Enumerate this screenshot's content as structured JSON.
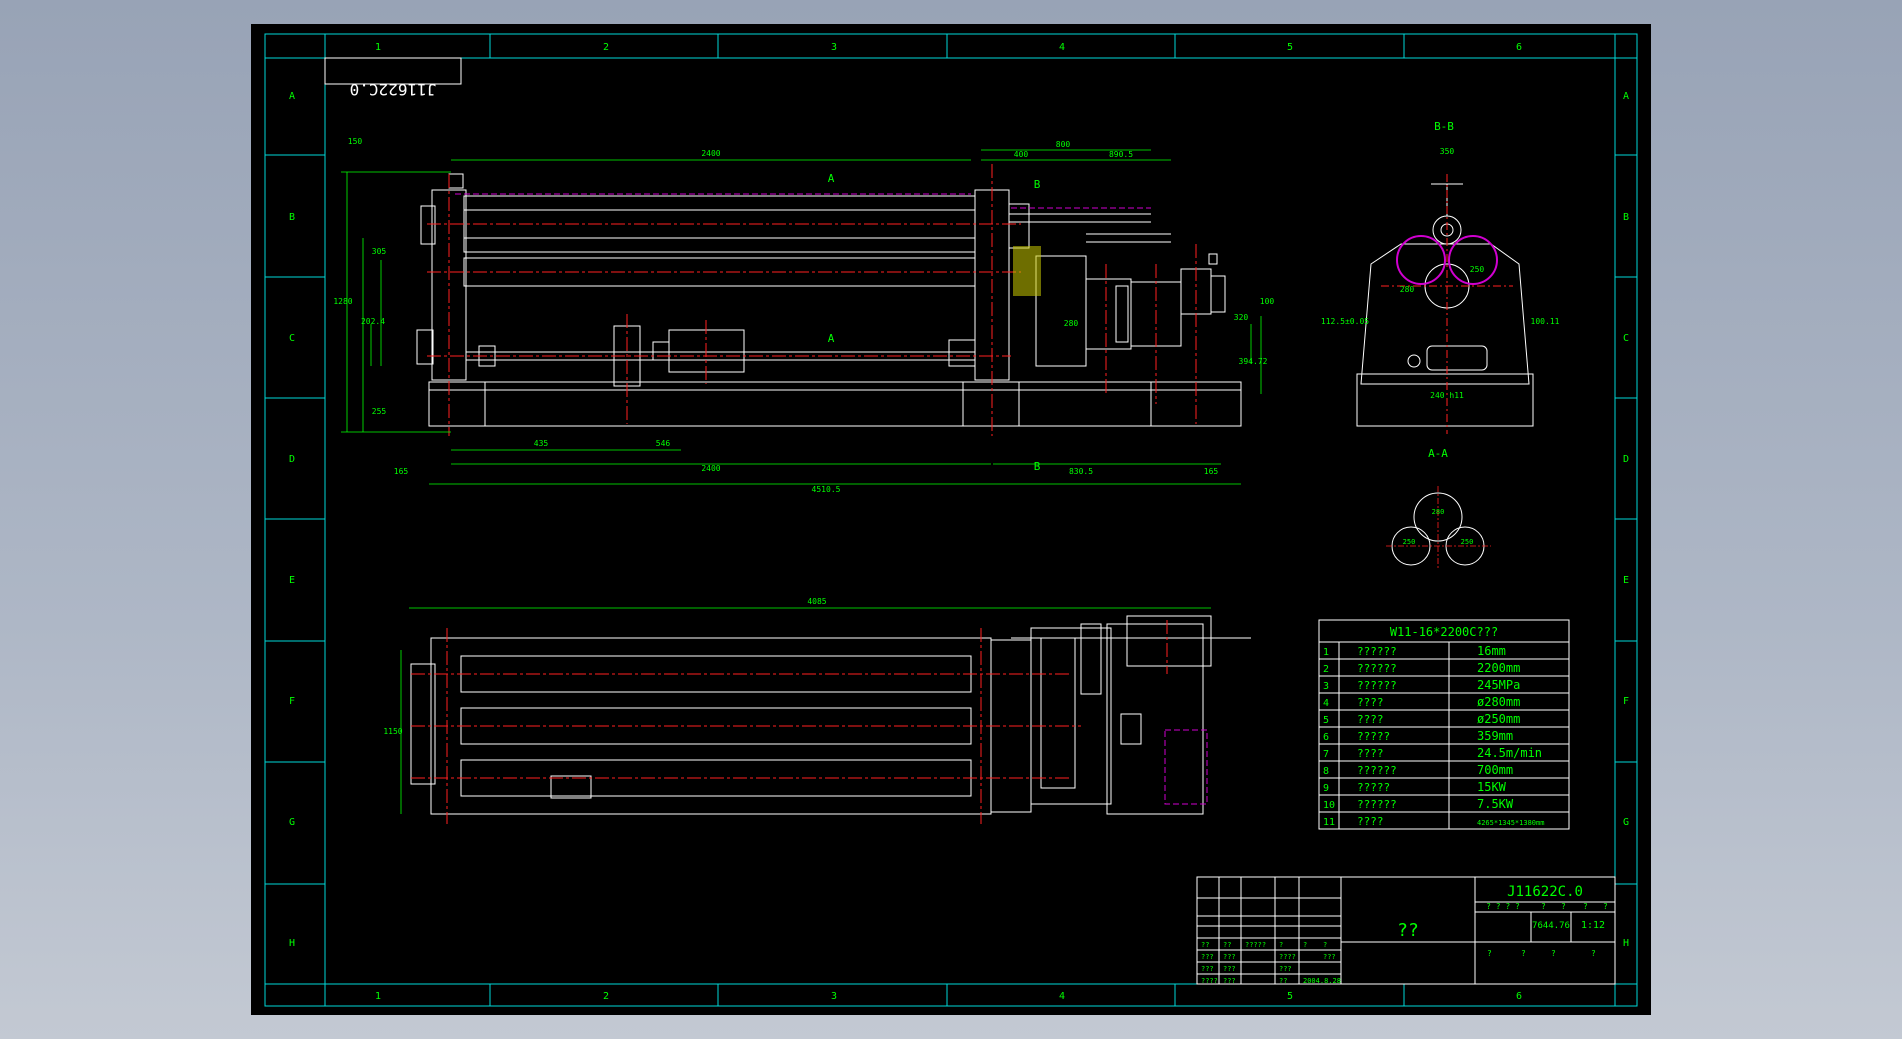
{
  "drawing": {
    "mirrored_code": "J11622C.0",
    "col_numbers": [
      "1",
      "2",
      "3",
      "4",
      "5",
      "6"
    ],
    "row_letters": [
      "A",
      "B",
      "C",
      "D",
      "E",
      "F",
      "G",
      "H"
    ],
    "row_letters_right": [
      "A",
      "B",
      "C",
      "D",
      "E",
      "F",
      "G",
      "H"
    ]
  },
  "front_view": {
    "section_a_top": "A",
    "section_a_bottom": "A",
    "section_b_top": "B",
    "section_b_bottom": "B",
    "dims_top": [
      "2400",
      "400",
      "800",
      "890.5",
      "150"
    ],
    "dims_left": [
      "1280",
      "305",
      "255",
      "202.4"
    ],
    "dims_right": [
      "320",
      "280",
      "394.72",
      "100"
    ],
    "dims_bottom": [
      "435",
      "546",
      "2400",
      "165",
      "165",
      "4510.5",
      "830.5",
      "165"
    ]
  },
  "section_bb": {
    "label": "B-B",
    "dims": [
      "350",
      "280",
      "250",
      "112.5±0.05",
      "100.11",
      "240 h11"
    ]
  },
  "section_aa": {
    "label": "A-A",
    "dims": [
      "280",
      "250",
      "250"
    ]
  },
  "top_view": {
    "dims": [
      "4085",
      "1150"
    ]
  },
  "spec_table": {
    "title": "W11-16*2200C???",
    "rows": [
      {
        "no": "1",
        "name": "??????",
        "value": "16mm"
      },
      {
        "no": "2",
        "name": "??????",
        "value": "2200mm"
      },
      {
        "no": "3",
        "name": "??????",
        "value": "245MPa"
      },
      {
        "no": "4",
        "name": "????",
        "value": "ø280mm"
      },
      {
        "no": "5",
        "name": "????",
        "value": "ø250mm"
      },
      {
        "no": "6",
        "name": "?????",
        "value": "359mm"
      },
      {
        "no": "7",
        "name": "????",
        "value": "24.5m/min"
      },
      {
        "no": "8",
        "name": "??????",
        "value": "700mm"
      },
      {
        "no": "9",
        "name": "?????",
        "value": "15KW"
      },
      {
        "no": "10",
        "name": "??????",
        "value": "7.5KW"
      },
      {
        "no": "11",
        "name": "????",
        "value": "4265*1345*1380mm"
      }
    ]
  },
  "title_block": {
    "center_text": "??",
    "drawing_no": "J11622C.0",
    "weight": "7644.76",
    "scale": "1:12",
    "header_marks": "? ? ? ?",
    "marks_small": [
      "?",
      "?",
      "?",
      "?"
    ],
    "left_rows": [
      [
        "??",
        "??",
        "?????",
        "?",
        "?",
        "?"
      ],
      [
        "???",
        "???",
        "",
        "????",
        "",
        "???"
      ],
      [
        "???",
        "???",
        "",
        "???",
        "",
        ""
      ],
      [
        "????",
        "???",
        "",
        "??",
        "2004.8.28",
        ""
      ]
    ],
    "bottom_marks": [
      "?",
      "?",
      "?",
      "?"
    ]
  }
}
